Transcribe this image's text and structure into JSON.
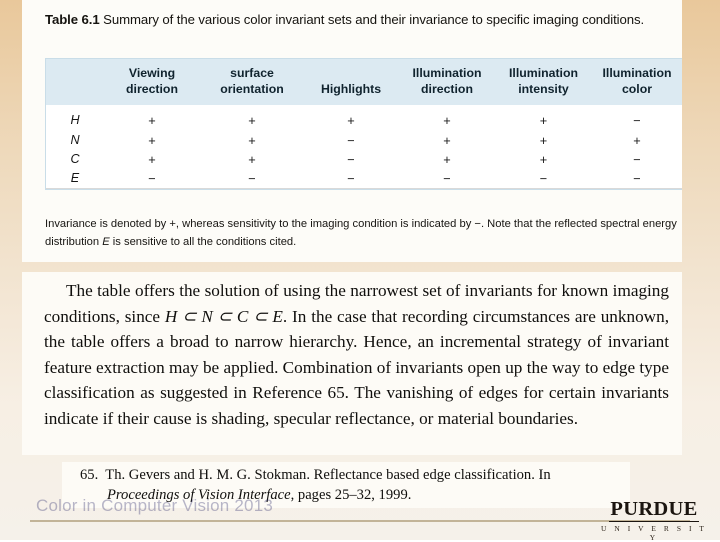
{
  "slide": {
    "footer_title": "Color in Computer Vision   2013",
    "logo": {
      "word": "PURDUE",
      "sub": "U N I V E R S I T Y"
    }
  },
  "table_block": {
    "caption_label": "Table 6.1",
    "caption_text": "Summary of the various color invariant sets and their invariance to specific imaging conditions.",
    "footnote_part1": "Invariance is denoted by +, whereas sensitivity to the imaging condition is indicated by −. Note that the reflected spectral energy distribution ",
    "footnote_em": "E",
    "footnote_part2": " is sensitive to all the conditions cited.",
    "columns": [
      "",
      "Viewing direction",
      "surface orientation",
      "Highlights",
      "Illumination direction",
      "Illumination intensity",
      "Illumination color"
    ],
    "rows": [
      {
        "label": "H",
        "values": [
          "+",
          "+",
          "+",
          "+",
          "+",
          "−"
        ]
      },
      {
        "label": "N",
        "values": [
          "+",
          "+",
          "−",
          "+",
          "+",
          "+"
        ]
      },
      {
        "label": "C",
        "values": [
          "+",
          "+",
          "−",
          "+",
          "+",
          "−"
        ]
      },
      {
        "label": "E",
        "values": [
          "−",
          "−",
          "−",
          "−",
          "−",
          "−"
        ]
      }
    ],
    "header_bg": "#dceaf2",
    "border_color": "#c9dde8"
  },
  "paragraph_block": {
    "seg1": "The table offers the solution of using the narrowest set of invariants for known imaging conditions, since ",
    "math": "H ⊂ N ⊂ C ⊂ E",
    "seg2": ". In the case that recording circumstances are unknown, the table offers a broad to narrow hierarchy. Hence, an incremental strategy of invariant feature extraction may be applied. Combination of invariants open up the way to edge type classification as suggested in Reference 65. The vanishing of edges for certain invariants indicate if their cause is shading, specular reflectance, or material boundaries."
  },
  "reference_block": {
    "number": "65.",
    "line1": "Th. Gevers and H. M. G. Stokman. Reflectance based edge classification. In",
    "italic": "Proceedings of Vision Interface",
    "line2": ", pages 25–32, 1999."
  }
}
